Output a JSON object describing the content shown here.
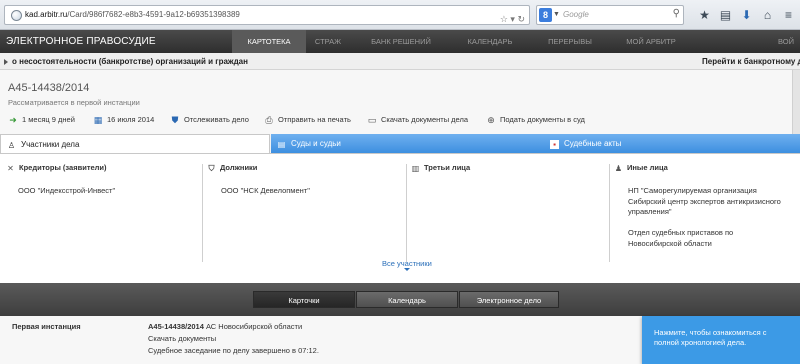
{
  "browser": {
    "url_host": "kad.arbitr.ru",
    "url_path": "/Card/986f7682-e8b3-4591-9a12-b69351398389",
    "search_engine_letter": "8",
    "search_placeholder": "Google",
    "icons": [
      "star-icon",
      "clipboard-icon",
      "download-icon",
      "home-icon",
      "menu-icon"
    ]
  },
  "site_nav": {
    "brand": "ЭЛЕКТРОННОЕ ПРАВОСУДИЕ",
    "items": [
      "КАРТОТЕКА",
      "СТРАЖ",
      "БАНК РЕШЕНИЙ",
      "КАЛЕНДАРЬ",
      "ПЕРЕРЫВЫ",
      "МОЙ АРБИТР",
      "ВОЙ"
    ],
    "active": "КАРТОТЕКА"
  },
  "info_bar": {
    "text": "о несостоятельности (банкротстве) организаций и граждан",
    "link": "Перейти к банкротному дел"
  },
  "case": {
    "number": "А45-14438/2014",
    "stage": "Рассматривается в первой инстанции",
    "actions": {
      "duration": "1 месяц 9 дней",
      "date": "16 июля 2014",
      "track": "Отслеживать дело",
      "print": "Отправить на печать",
      "download": "Скачать документы дела",
      "submit": "Подать документы в суд"
    }
  },
  "tabs": {
    "parties": "Участники дела",
    "courts": "Суды и судьи",
    "acts": "Судебные акты"
  },
  "participants": {
    "creditors": {
      "title": "Кредиторы (заявители)",
      "entries": [
        "ООО \"Индексстрой-Инвест\""
      ]
    },
    "debtors": {
      "title": "Должники",
      "entries": [
        "ООО \"НСК Девелопмент\""
      ]
    },
    "third": {
      "title": "Третьи лица",
      "entries": []
    },
    "others": {
      "title": "Иные лица",
      "entries": [
        "НП \"Саморегулируемая организация",
        "Сибирский центр экспертов антикризисного",
        "управления\"",
        "",
        "Отдел судебных приставов по",
        "Новосибирской области"
      ]
    },
    "all_link": "Все участники"
  },
  "bottom_tabs": [
    "Карточки",
    "Календарь",
    "Электронное дело"
  ],
  "bottom_active": "Карточки",
  "instance": {
    "label": "Первая инстанция",
    "case_number": "А45-14438/2014",
    "court": " АС Новосибирской области",
    "docs": "Скачать документы",
    "session": "Судебное заседание по делу завершено в 07:12."
  },
  "tooltip": {
    "line1": "Нажмите, чтобы ознакомиться с",
    "line2": "полной хронологией дела."
  }
}
